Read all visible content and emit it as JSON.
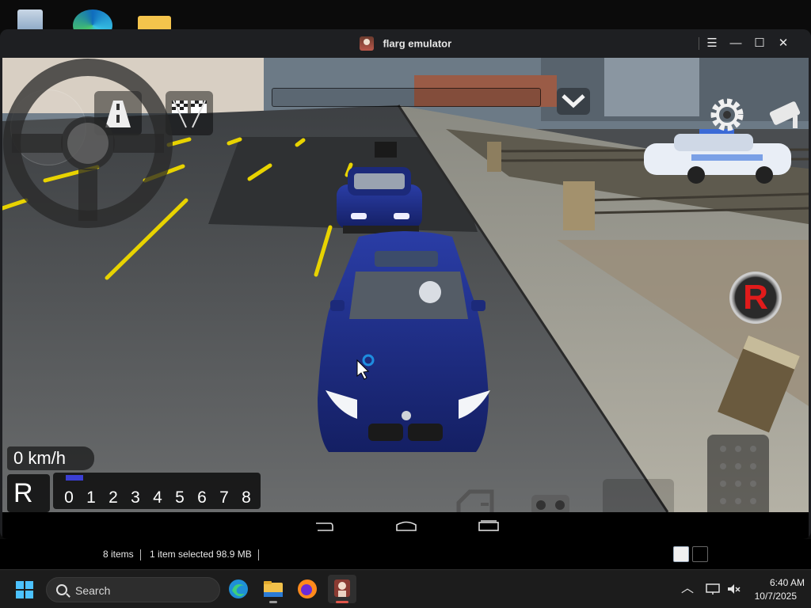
{
  "window": {
    "title": "flarg emulator",
    "controls": {
      "menu": "☰",
      "minimize": "—",
      "maximize": "☐",
      "close": "✕"
    }
  },
  "game": {
    "speed_display": "0 km/h",
    "gear": "R",
    "rpm_scale": [
      "0",
      "1",
      "2",
      "3",
      "4",
      "5",
      "6",
      "7",
      "8"
    ],
    "rpm_level": 0.05,
    "reverse_button": "R",
    "icons": [
      "road-icon",
      "checkered-flag-icon",
      "gear-icon",
      "camera-icon",
      "chevron-down-icon",
      "steering-wheel-icon",
      "car-door-icon",
      "headlights-icon",
      "gas-pedal-icon"
    ]
  },
  "android_nav": {
    "icons": [
      "back-icon",
      "home-icon",
      "recents-icon"
    ]
  },
  "explorer_status": {
    "items": "8 items",
    "selected": "1 item selected  98.9 MB"
  },
  "taskbar": {
    "search_placeholder": "Search",
    "apps": [
      "edge-icon",
      "file-explorer-icon",
      "firefox-icon",
      "flarg-emulator-icon"
    ],
    "clock_time": "6:40 AM",
    "clock_date": "10/7/2025"
  },
  "colors": {
    "accent": "#4cc2ff",
    "car_blue": "#1d2f86",
    "reverse_red": "#e11b1b"
  }
}
